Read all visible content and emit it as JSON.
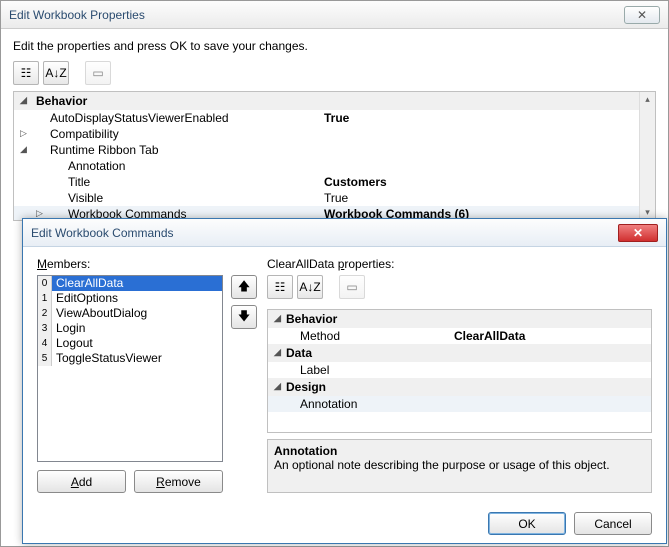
{
  "dialog1": {
    "title": "Edit Workbook Properties",
    "instruct": "Edit the properties and press OK to save your changes.",
    "toolbar": {
      "cat_icon": "☷",
      "az_icon": "A↓Z",
      "page_icon": "▭"
    },
    "grid": {
      "cat_behavior": "Behavior",
      "rows": [
        {
          "name": "AutoDisplayStatusViewerEnabled",
          "val": "True",
          "bold": true
        },
        {
          "name": "Compatibility",
          "val": "",
          "expander": "▷"
        },
        {
          "name": "Runtime Ribbon Tab",
          "val": "",
          "expander": "◢"
        }
      ],
      "subrows": [
        {
          "name": "Annotation",
          "val": ""
        },
        {
          "name": "Title",
          "val": "Customers",
          "bold": true
        },
        {
          "name": "Visible",
          "val": "True"
        },
        {
          "name": "Workbook Commands",
          "val": "Workbook Commands (6)",
          "bold": true,
          "expander": "▷",
          "highlight": true
        }
      ]
    }
  },
  "dialog2": {
    "title": "Edit Workbook Commands",
    "members_label": "Members:",
    "members": [
      "ClearAllData",
      "EditOptions",
      "ViewAboutDialog",
      "Login",
      "Logout",
      "ToggleStatusViewer"
    ],
    "selected_index": 0,
    "add_label": "Add",
    "remove_label": "Remove",
    "up_icon": "🡅",
    "down_icon": "🡇",
    "props_label": "ClearAllData properties:",
    "toolbar": {
      "cat_icon": "☷",
      "az_icon": "A↓Z",
      "page_icon": "▭"
    },
    "pgrid": {
      "cat_behavior": "Behavior",
      "method_name": "Method",
      "method_val": "ClearAllData",
      "cat_data": "Data",
      "label_name": "Label",
      "label_val": "",
      "cat_design": "Design",
      "annotation_name": "Annotation",
      "annotation_val": ""
    },
    "help": {
      "title": "Annotation",
      "desc": "An optional note describing the purpose or usage of this object."
    },
    "ok": "OK",
    "cancel": "Cancel"
  }
}
